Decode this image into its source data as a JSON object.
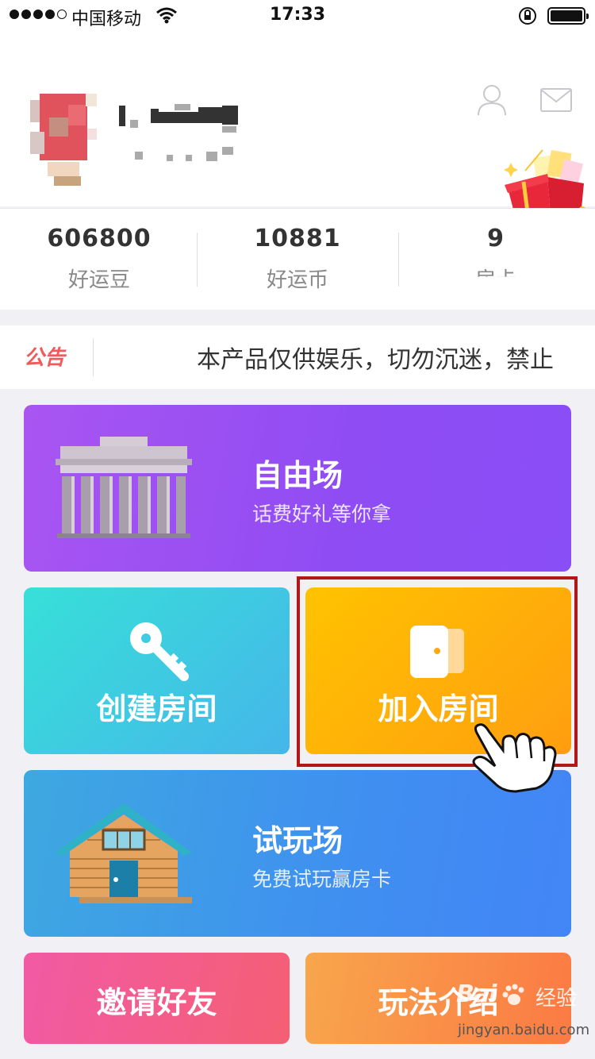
{
  "status_bar": {
    "carrier": "中国移动",
    "time": "17:33"
  },
  "stats": [
    {
      "value": "606800",
      "label": "好运豆"
    },
    {
      "value": "10881",
      "label": "好运币"
    },
    {
      "value": "9",
      "label": "房卡"
    }
  ],
  "notice": {
    "tag": "公告",
    "text": "本产品仅供娱乐，切勿沉迷，禁止"
  },
  "cards": {
    "free": {
      "title": "自由场",
      "subtitle": "话费好礼等你拿"
    },
    "create": {
      "title": "创建房间"
    },
    "join": {
      "title": "加入房间"
    },
    "trial": {
      "title": "试玩场",
      "subtitle": "免费试玩赢房卡"
    },
    "invite": {
      "title": "邀请好友"
    },
    "rules": {
      "title": "玩法介绍"
    }
  },
  "watermark": {
    "logo": "Bai",
    "brand": "经验",
    "url": "jingyan.baidu.com"
  },
  "icons": {
    "status": [
      "signal-icon",
      "wifi-icon",
      "orientation-lock-icon",
      "battery-icon"
    ],
    "header": [
      "user-icon",
      "mail-icon",
      "gift-box-icon"
    ],
    "cards": [
      "building-icon",
      "key-icon",
      "door-icon",
      "cabin-icon",
      "pointing-hand-icon"
    ]
  },
  "colors": {
    "notice_tag": "#f05a5a",
    "free_card": "#9a50f3",
    "create_card": "#3fcbe2",
    "join_card": "#ffb006",
    "trial_card": "#3f97ea",
    "invite_card": "#f35d8a",
    "rules_card": "#f99049",
    "highlight_border": "#b01818"
  }
}
